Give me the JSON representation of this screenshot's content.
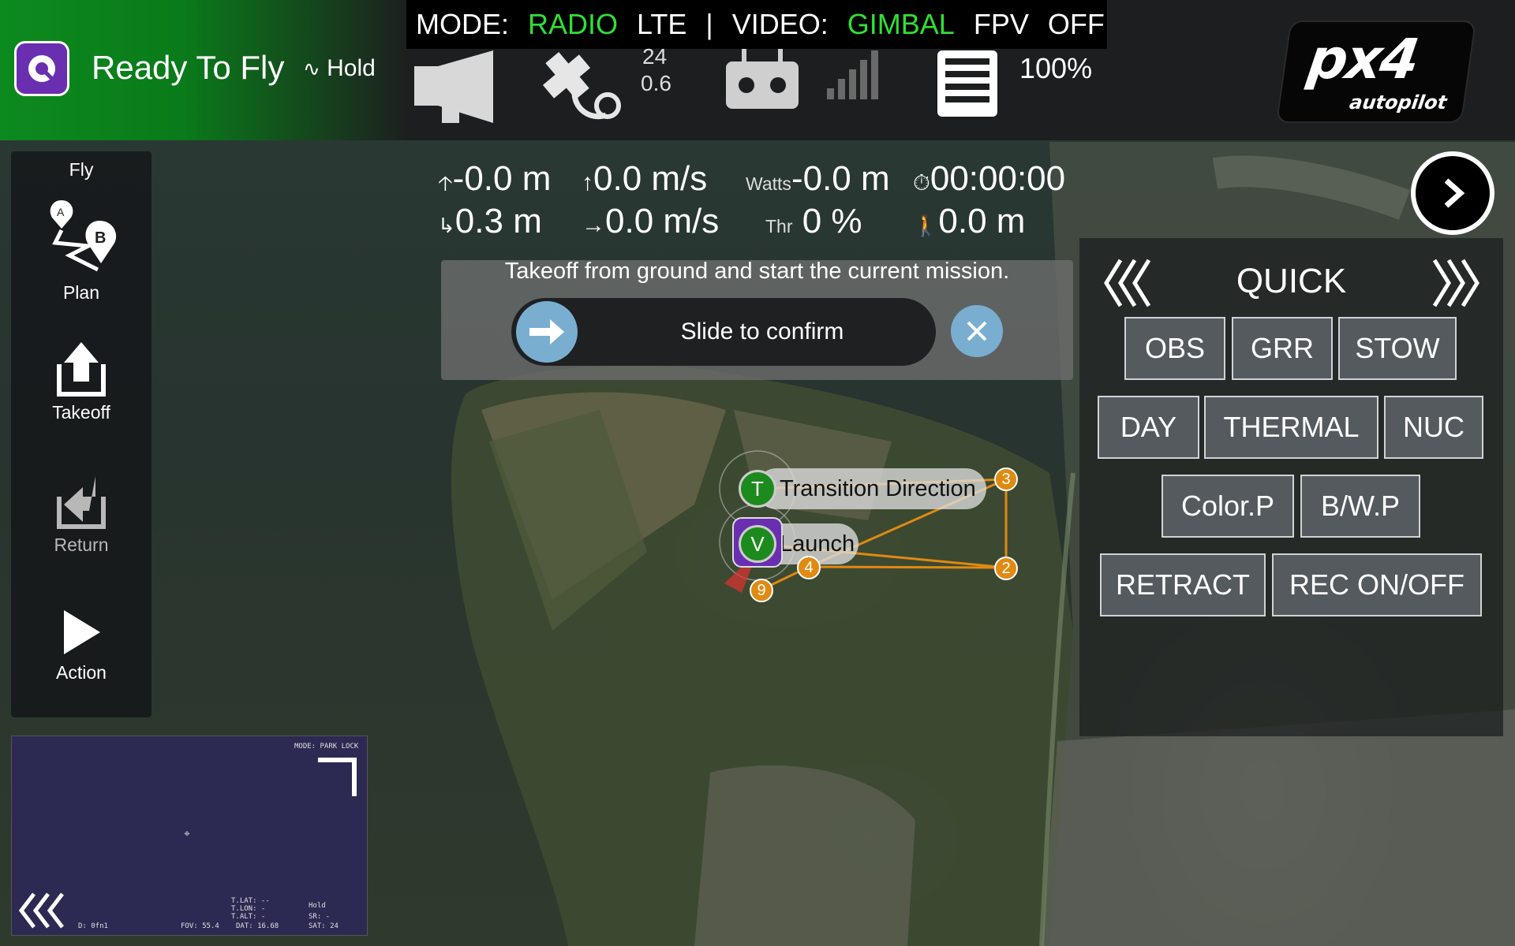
{
  "topbar": {
    "status": "Ready To Fly",
    "flight_mode": "Hold",
    "mode_label": "MODE:",
    "mode_radio": "RADIO",
    "mode_lte": "LTE",
    "separator": "|",
    "video_label": "VIDEO:",
    "video_gimbal": "GIMBAL",
    "video_fpv": "FPV",
    "video_off": "OFF",
    "gps_sats": "24",
    "gps_hdop": "0.6",
    "battery": "100%",
    "logo_main": "px4",
    "logo_sub": "autopilot"
  },
  "toolbar": {
    "fly": "Fly",
    "plan": "Plan",
    "takeoff": "Takeoff",
    "return": "Return",
    "action": "Action"
  },
  "telemetry": {
    "altitude": "-0.0 m",
    "climb_rate": "0.0 m/s",
    "watts_label": "Watts",
    "watts_value": "-0.0 m",
    "flight_time": "00:00:00",
    "distance_home": "0.3 m",
    "ground_speed": "0.0 m/s",
    "thr_label": "Thr",
    "throttle": "0 %",
    "distance": "0.0 m"
  },
  "guided": {
    "message": "Takeoff from ground and start the current mission.",
    "slider_label": "Slide to confirm"
  },
  "quick": {
    "title": "QUICK",
    "rows": [
      [
        "OBS",
        "GRR",
        "STOW"
      ],
      [
        "DAY",
        "THERMAL",
        "NUC"
      ],
      [
        "Color.P",
        "B/W.P"
      ],
      [
        "RETRACT",
        "REC ON/OFF"
      ]
    ]
  },
  "mission": {
    "transition_marker": "T",
    "transition_label": "Transition Direction",
    "launch_marker": "V",
    "launch_label": "Launch",
    "waypoints": [
      "2",
      "3",
      "4",
      "9"
    ]
  },
  "video": {
    "mode": "MODE: PARK LOCK",
    "lat": "T.LAT: --",
    "lon": "T.LON: -",
    "alt": "T.ALT: -",
    "dat": "DAT: 16.68",
    "fov": "FOV: 55.4",
    "zoom": "D: 0fn1",
    "hold": "Hold",
    "sr": "SR: -",
    "sat": "SAT: 24"
  },
  "colors": {
    "ready_green": "#0c8a1e",
    "mode_active": "#2fe034",
    "waypoint_orange": "#e08a12",
    "confirm_blue": "#7aaed0"
  }
}
